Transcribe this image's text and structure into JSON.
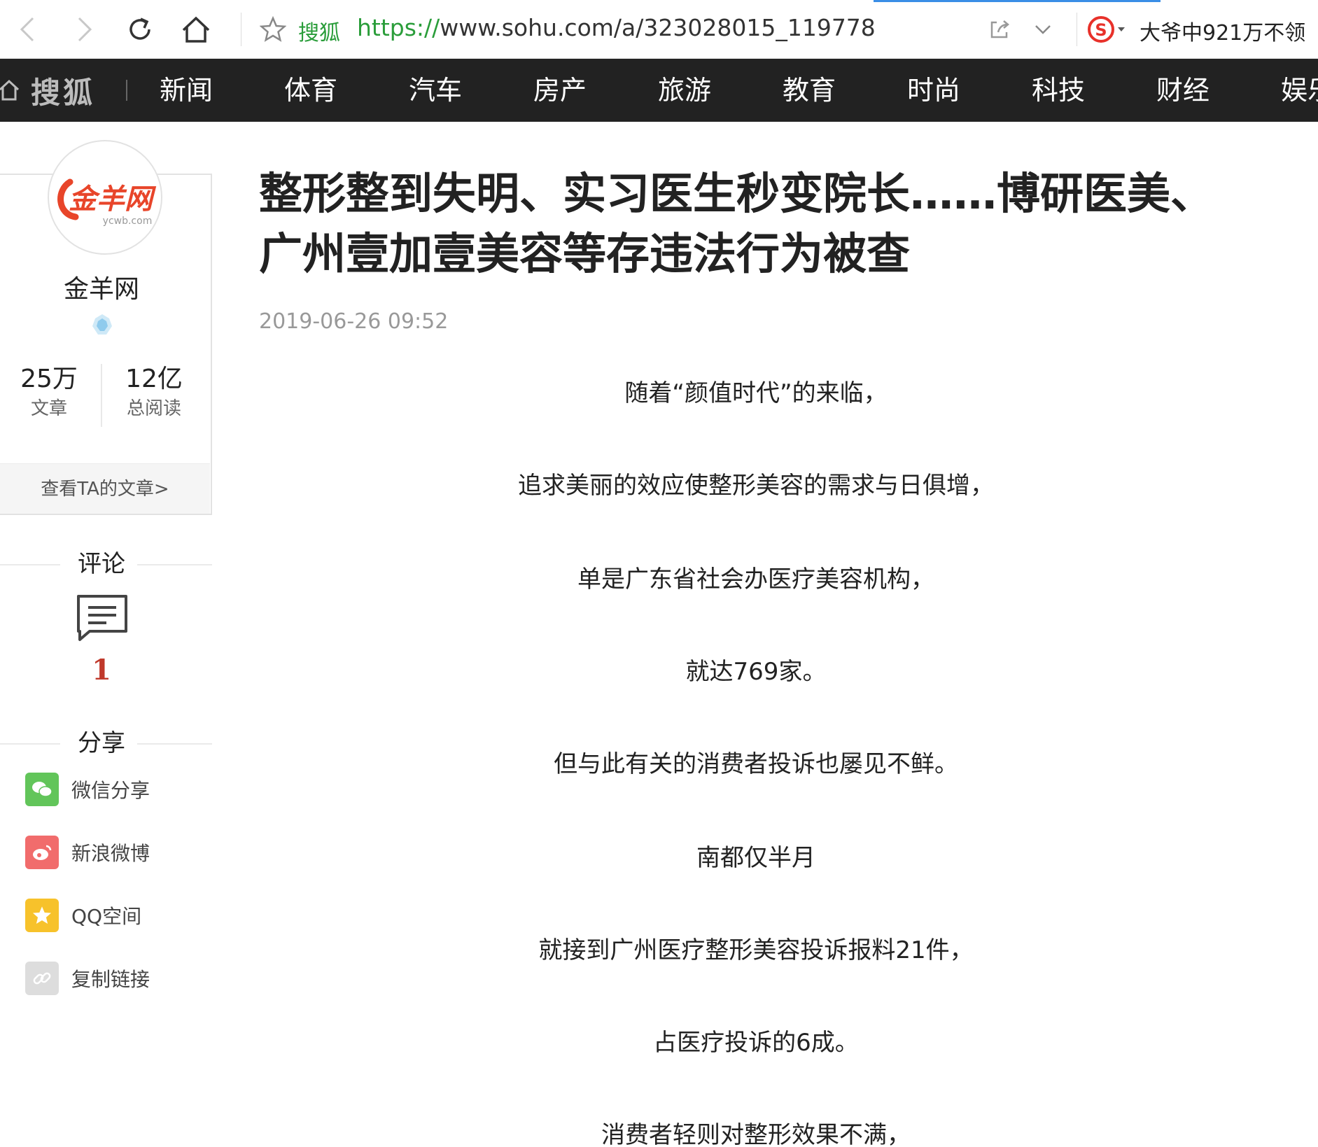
{
  "browser": {
    "site_name": "搜狐",
    "url_scheme": "https://",
    "url_rest": "www.sohu.com/a/323028015_119778",
    "promo_text": "大爷中921万不领"
  },
  "nav": {
    "logo": "搜狐",
    "items": [
      "新闻",
      "体育",
      "汽车",
      "房产",
      "旅游",
      "教育",
      "时尚",
      "科技",
      "财经",
      "娱乐"
    ]
  },
  "author": {
    "logo_text": "金羊网",
    "logo_subtext": "ycwb.com",
    "name": "金羊网",
    "stats": [
      {
        "num": "25万",
        "label": "文章"
      },
      {
        "num": "12亿",
        "label": "总阅读"
      }
    ],
    "view_articles": "查看TA的文章>"
  },
  "comments": {
    "title": "评论",
    "count": "1"
  },
  "share": {
    "title": "分享",
    "items": [
      {
        "label": "微信分享",
        "color": "#62c55a",
        "icon": "wechat-icon"
      },
      {
        "label": "新浪微博",
        "color": "#f16c6c",
        "icon": "weibo-icon"
      },
      {
        "label": "QQ空间",
        "color": "#f7c22b",
        "icon": "qzone-icon"
      },
      {
        "label": "复制链接",
        "color": "#dddddd",
        "icon": "link-icon"
      }
    ]
  },
  "article": {
    "title_line1": "整形整到失明、实习医生秒变院长……博研医美、",
    "title_line2": "广州壹加壹美容等存违法行为被查",
    "time": "2019-06-26 09:52",
    "paragraphs": [
      "随着“颜值时代”的来临，",
      "追求美丽的效应使整形美容的需求与日俱增，",
      "单是广东省社会办医疗美容机构，",
      "就达769家。",
      "但与此有关的消费者投诉也屡见不鲜。",
      "南都仅半月",
      "就接到广州医疗整形美容投诉报料21件，",
      "占医疗投诉的6成。",
      "消费者轻则对整形效果不满，"
    ]
  }
}
